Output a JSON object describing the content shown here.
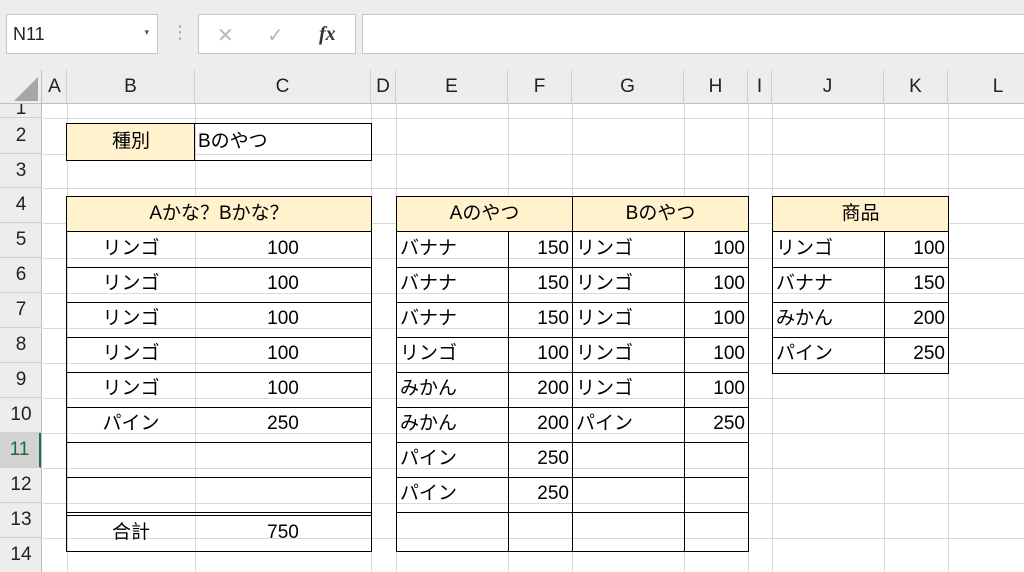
{
  "name_box": {
    "value": "N11",
    "dropdown_glyph": "▾"
  },
  "formula_bar": {
    "value": "",
    "cancel_glyph": "✕",
    "enter_glyph": "✓",
    "fx_glyph": "fx",
    "separator_glyph": "⋮"
  },
  "columns": [
    "A",
    "B",
    "C",
    "D",
    "E",
    "F",
    "G",
    "H",
    "I",
    "J",
    "K",
    "L"
  ],
  "rows": [
    "1",
    "2",
    "3",
    "4",
    "5",
    "6",
    "7",
    "8",
    "9",
    "10",
    "11",
    "12",
    "13",
    "14"
  ],
  "selected_row": "11",
  "table_type": {
    "label": "種別",
    "value": "Bのやつ"
  },
  "table_main": {
    "header": "Aかな？Bかな？",
    "rows": [
      {
        "name": "リンゴ",
        "value": "100"
      },
      {
        "name": "リンゴ",
        "value": "100"
      },
      {
        "name": "リンゴ",
        "value": "100"
      },
      {
        "name": "リンゴ",
        "value": "100"
      },
      {
        "name": "リンゴ",
        "value": "100"
      },
      {
        "name": "パイン",
        "value": "250"
      },
      {
        "name": "",
        "value": ""
      },
      {
        "name": "",
        "value": ""
      }
    ],
    "total_label": "合計",
    "total_value": "750"
  },
  "table_ab": {
    "header_a": "Aのやつ",
    "header_b": "Bのやつ",
    "a_rows": [
      {
        "name": "バナナ",
        "value": "150"
      },
      {
        "name": "バナナ",
        "value": "150"
      },
      {
        "name": "バナナ",
        "value": "150"
      },
      {
        "name": "リンゴ",
        "value": "100"
      },
      {
        "name": "みかん",
        "value": "200"
      },
      {
        "name": "みかん",
        "value": "200"
      },
      {
        "name": "パイン",
        "value": "250"
      },
      {
        "name": "パイン",
        "value": "250"
      },
      {
        "name": "",
        "value": ""
      }
    ],
    "b_rows": [
      {
        "name": "リンゴ",
        "value": "100"
      },
      {
        "name": "リンゴ",
        "value": "100"
      },
      {
        "name": "リンゴ",
        "value": "100"
      },
      {
        "name": "リンゴ",
        "value": "100"
      },
      {
        "name": "リンゴ",
        "value": "100"
      },
      {
        "name": "パイン",
        "value": "250"
      },
      {
        "name": "",
        "value": ""
      },
      {
        "name": "",
        "value": ""
      },
      {
        "name": "",
        "value": ""
      }
    ]
  },
  "table_products": {
    "header": "商品",
    "rows": [
      {
        "name": "リンゴ",
        "value": "100"
      },
      {
        "name": "バナナ",
        "value": "150"
      },
      {
        "name": "みかん",
        "value": "200"
      },
      {
        "name": "パイン",
        "value": "250"
      }
    ]
  },
  "colors": {
    "header_fill": "#fff2cc",
    "selection_accent": "#217346"
  }
}
